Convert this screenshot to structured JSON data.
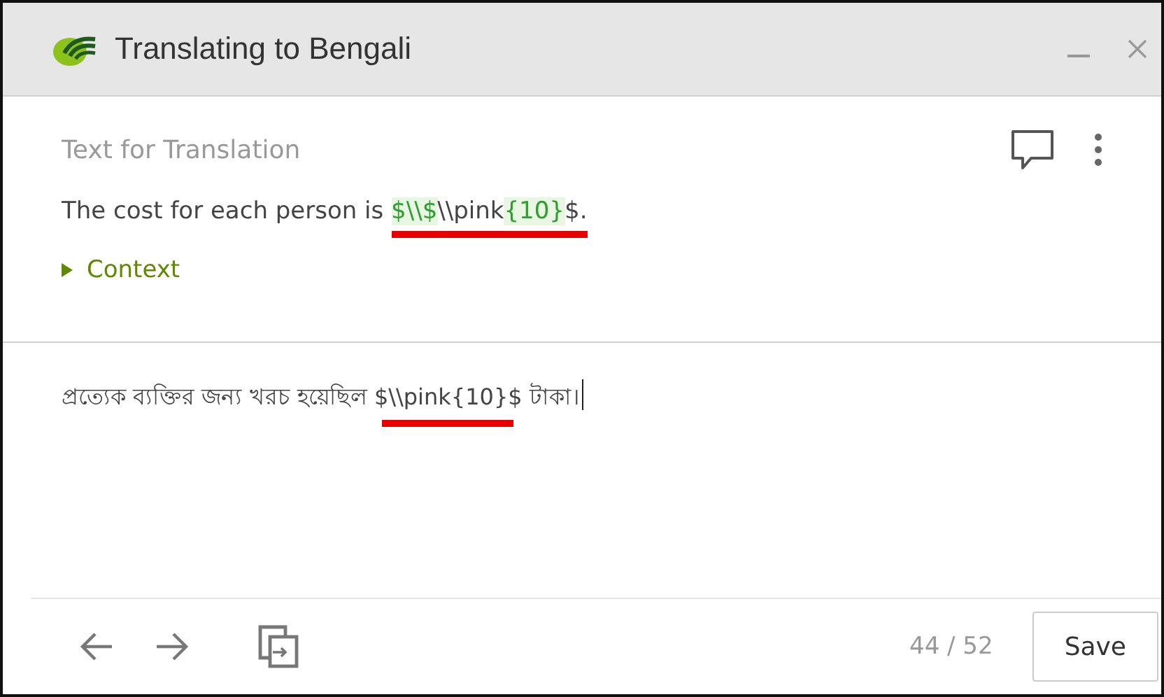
{
  "window": {
    "title": "Translating to Bengali"
  },
  "source": {
    "heading": "Text for Translation",
    "before": "The cost for each person is ",
    "marked": [
      {
        "text": "$\\\\$",
        "kind": "tag"
      },
      {
        "text": "\\\\pink",
        "kind": "plain"
      },
      {
        "text": "{10}",
        "kind": "tag"
      },
      {
        "text": "$.",
        "kind": "plain"
      }
    ],
    "context": {
      "label": "Context",
      "expanded": false
    }
  },
  "translation": {
    "before": "প্রত্যেক ব্যক্তির জন্য খরচ হয়েছিল ",
    "marked": "$\\\\pink{10}$",
    "after": " টাকা।"
  },
  "footer": {
    "progress": "44 / 52",
    "save": "Save"
  }
}
